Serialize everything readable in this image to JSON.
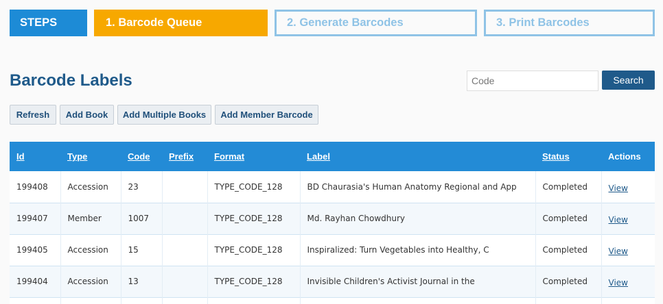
{
  "steps": {
    "label": "STEPS",
    "items": [
      "1. Barcode Queue",
      "2. Generate Barcodes",
      "3. Print Barcodes"
    ]
  },
  "page": {
    "title": "Barcode Labels"
  },
  "search": {
    "placeholder": "Code",
    "button_label": "Search"
  },
  "toolbar": {
    "refresh_label": "Refresh",
    "add_book_label": "Add Book",
    "add_multiple_books_label": "Add Multiple Books",
    "add_member_barcode_label": "Add Member Barcode"
  },
  "table": {
    "columns": [
      "Id",
      "Type",
      "Code",
      "Prefix",
      "Format",
      "Label",
      "Status",
      "Actions"
    ],
    "rows": [
      {
        "id": "199408",
        "type": "Accession",
        "code": "23",
        "prefix": "",
        "format": "TYPE_CODE_128",
        "label": "BD Chaurasia's Human Anatomy Regional and App",
        "status": "Completed",
        "action": "View"
      },
      {
        "id": "199407",
        "type": "Member",
        "code": "1007",
        "prefix": "",
        "format": "TYPE_CODE_128",
        "label": "Md. Rayhan Chowdhury",
        "status": "Completed",
        "action": "View"
      },
      {
        "id": "199405",
        "type": "Accession",
        "code": "15",
        "prefix": "",
        "format": "TYPE_CODE_128",
        "label": "Inspiralized: Turn Vegetables into Healthy, C",
        "status": "Completed",
        "action": "View"
      },
      {
        "id": "199404",
        "type": "Accession",
        "code": "13",
        "prefix": "",
        "format": "TYPE_CODE_128",
        "label": "Invisible Children's Activist Journal in the",
        "status": "Completed",
        "action": "View"
      }
    ]
  },
  "colors": {
    "steps_label_bg": "#1d8bd6",
    "active_step_bg": "#f7a800",
    "inactive_step": "#8fc3e6",
    "title": "#1f5a8a",
    "table_header_bg": "#238bd6",
    "search_button_bg": "#1f5a8a"
  }
}
